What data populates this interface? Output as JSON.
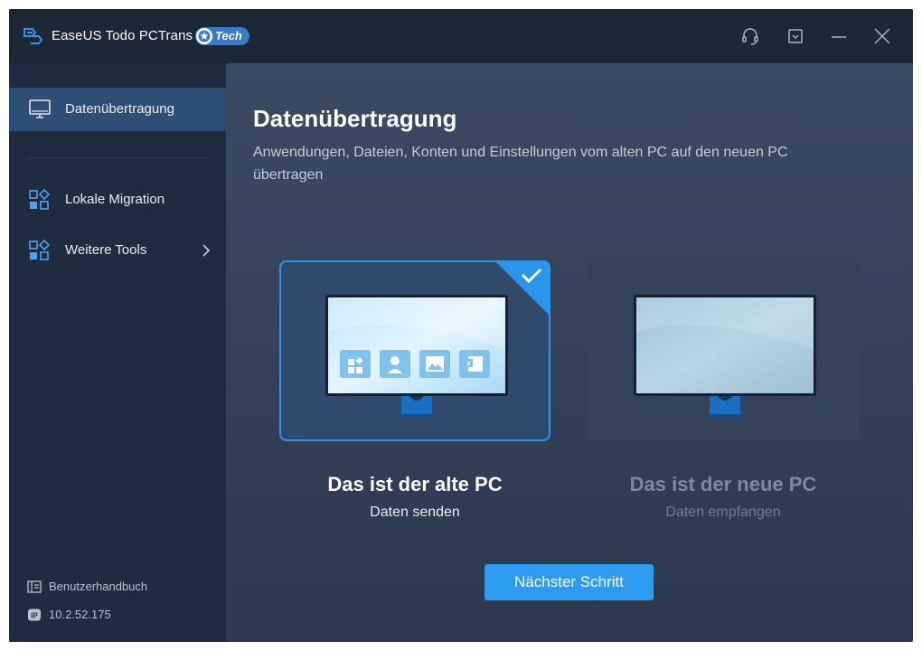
{
  "app": {
    "title": "EaseUS Todo PCTrans",
    "badge": "Tech",
    "icons": {
      "logo": "transfer-arrow-icon",
      "support": "headset-icon",
      "menu": "dropdown-menu-icon",
      "minimize": "minimize-icon",
      "close": "close-icon"
    }
  },
  "sidebar": {
    "items": [
      {
        "label": "Datenübertragung",
        "icon": "monitor-icon",
        "active": true
      },
      {
        "label": "Lokale Migration",
        "icon": "app-grid-icon",
        "active": false
      },
      {
        "label": "Weitere Tools",
        "icon": "app-grid-icon",
        "active": false,
        "has_submenu": true
      }
    ],
    "footer": {
      "manual_label": "Benutzerhandbuch",
      "ip_label": "10.2.52.175",
      "manual_icon": "book-icon",
      "ip_icon": "ip-badge-icon"
    }
  },
  "main": {
    "title": "Datenübertragung",
    "subtitle": "Anwendungen, Dateien, Konten und Einstellungen vom alten PC auf den neuen PC übertragen",
    "cards": [
      {
        "title": "Das ist der alte PC",
        "subtitle": "Daten senden",
        "selected": true
      },
      {
        "title": "Das ist der neue PC",
        "subtitle": "Daten empfangen",
        "selected": false
      }
    ],
    "next_button": "Nächster Schritt"
  },
  "colors": {
    "accent": "#2d9bf0",
    "sidebar_bg": "#1f2b3e",
    "active_item": "#2d4f77",
    "main_bg": "#3b4a63",
    "text_muted": "#7c8aa0"
  }
}
